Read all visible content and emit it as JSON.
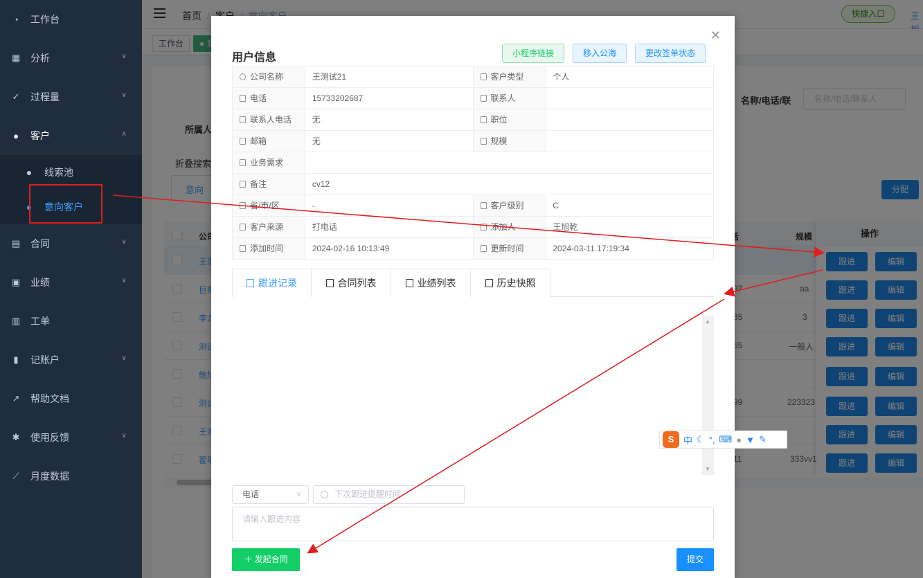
{
  "sidebar": {
    "items": [
      {
        "label": "工作台",
        "icon": "dashboard-icon"
      },
      {
        "label": "分析",
        "icon": "chart-icon"
      },
      {
        "label": "过程量",
        "icon": "process-icon"
      },
      {
        "label": "客户",
        "icon": "user-icon"
      },
      {
        "label": "线索池",
        "icon": "user-icon"
      },
      {
        "label": "意向客户",
        "icon": "user-icon"
      },
      {
        "label": "合同",
        "icon": "document-icon"
      },
      {
        "label": "业绩",
        "icon": "briefcase-icon"
      },
      {
        "label": "工单",
        "icon": "clipboard-icon"
      },
      {
        "label": "记账户",
        "icon": "book-icon"
      },
      {
        "label": "帮助文档",
        "icon": "external-link-icon"
      },
      {
        "label": "使用反馈",
        "icon": "bug-icon"
      },
      {
        "label": "月度数据",
        "icon": "line-chart-icon"
      }
    ]
  },
  "topbar": {
    "breadcrumb": [
      "首页",
      "客户",
      "意向客户"
    ],
    "quick_entry": "快捷入口",
    "user": "王旭"
  },
  "tags": [
    "工作台",
    "意"
  ],
  "background": {
    "name_search_label": "名称/电话/联",
    "name_search_placeholder": "名称/电话/联系人",
    "owner_label": "所属人",
    "fold_label": "折叠搜索",
    "tab_label": "意向",
    "assign": "分配",
    "table": {
      "headers": {
        "company": "公司",
        "phone": "话",
        "scale": "规模",
        "ops": "操作"
      },
      "rows": [
        {
          "name": "王测",
          "phone": "",
          "scale": ""
        },
        {
          "name": "巨鼎",
          "phone": "97",
          "scale": "aa"
        },
        {
          "name": "李龙",
          "phone": "85",
          "scale": "3"
        },
        {
          "name": "测试",
          "phone": "65",
          "scale": "一般人"
        },
        {
          "name": "鲍旭",
          "phone": "",
          "scale": ""
        },
        {
          "name": "测试",
          "phone": "99",
          "scale": "223323"
        },
        {
          "name": "王测",
          "phone": "",
          "scale": ""
        },
        {
          "name": "翟明",
          "phone": "11",
          "scale": "333vv1"
        }
      ],
      "follow": "跟进",
      "edit": "编辑"
    }
  },
  "modal": {
    "title": "用户信息",
    "btn_miniapp": "小程序链接",
    "btn_sea": "移入公海",
    "btn_sign": "更改签单状态",
    "info": {
      "company_label": "公司名称",
      "company": "王测试21",
      "ctype_label": "客户类型",
      "ctype": "个人",
      "phone_label": "电话",
      "phone": "15733202687",
      "contact_label": "联系人",
      "contact": "",
      "cphone_label": "联系人电话",
      "cphone": "无",
      "position_label": "职位",
      "position": "",
      "email_label": "邮箱",
      "email": "无",
      "scale_label": "规模",
      "scale": "",
      "need_label": "业务需求",
      "need": "",
      "remark_label": "备注",
      "remark": "cv12",
      "region_label": "省/市/区",
      "region": "-",
      "level_label": "客户级别",
      "level": "C",
      "source_label": "客户来源",
      "source": "打电话",
      "adder_label": "添加人",
      "adder": "王旭乾",
      "addtime_label": "添加时间",
      "addtime": "2024-02-16 10:13:49",
      "updtime_label": "更新时间",
      "updtime": "2024-03-11 17:19:34"
    },
    "tabs": [
      "跟进记录",
      "合同列表",
      "业绩列表",
      "历史快照"
    ],
    "follow_type": "电话",
    "reminder_placeholder": "下次跟进提醒时间",
    "content_placeholder": "请输入跟进内容",
    "btn_contract": "发起合同",
    "btn_submit": "提交"
  },
  "ime": {
    "lang": "中"
  }
}
